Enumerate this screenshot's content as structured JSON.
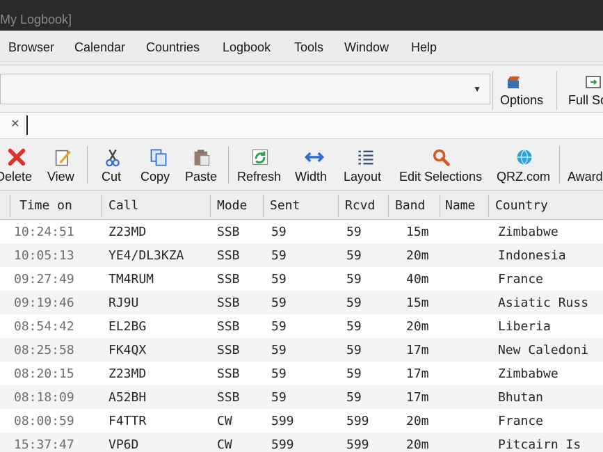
{
  "window": {
    "title": "My Logbook]"
  },
  "menu": [
    "Browser",
    "Calendar",
    "Countries",
    "Logbook",
    "Tools",
    "Window",
    "Help"
  ],
  "address_bar": {
    "value": ""
  },
  "big_buttons": {
    "options": "Options",
    "full_screen": "Full Sc"
  },
  "toolbar": {
    "delete": "Delete",
    "view": "View",
    "cut": "Cut",
    "copy": "Copy",
    "paste": "Paste",
    "refresh": "Refresh",
    "width": "Width",
    "layout": "Layout",
    "edit_selections": "Edit Selections",
    "qrz": "QRZ.com",
    "award": "Award"
  },
  "columns": [
    "Time on",
    "Call",
    "Mode",
    "Sent",
    "Rcvd",
    "Band",
    "Name",
    "Country"
  ],
  "rows": [
    [
      "10:24:51",
      "Z23MD",
      "SSB",
      "59",
      "59",
      "15m",
      "",
      "Zimbabwe"
    ],
    [
      "10:05:13",
      "YE4/DL3KZA",
      "SSB",
      "59",
      "59",
      "20m",
      "",
      "Indonesia"
    ],
    [
      "09:27:49",
      "TM4RUM",
      "SSB",
      "59",
      "59",
      "40m",
      "",
      "France"
    ],
    [
      "09:19:46",
      "RJ9U",
      "SSB",
      "59",
      "59",
      "15m",
      "",
      "Asiatic Russ"
    ],
    [
      "08:54:42",
      "EL2BG",
      "SSB",
      "59",
      "59",
      "20m",
      "",
      "Liberia"
    ],
    [
      "08:25:58",
      "FK4QX",
      "SSB",
      "59",
      "59",
      "17m",
      "",
      "New Caledoni"
    ],
    [
      "08:20:15",
      "Z23MD",
      "SSB",
      "59",
      "59",
      "17m",
      "",
      "Zimbabwe"
    ],
    [
      "08:18:09",
      "A52BH",
      "SSB",
      "59",
      "59",
      "17m",
      "",
      "Bhutan"
    ],
    [
      "08:00:59",
      "F4TTR",
      "CW",
      "599",
      "599",
      "20m",
      "",
      "France"
    ],
    [
      "15:37:47",
      "VP6D",
      "CW",
      "599",
      "599",
      "20m",
      "",
      "Pitcairn Is"
    ]
  ],
  "colors": {
    "delete": "#d9352b",
    "refresh": "#2e9b46",
    "width": "#2f6fd0",
    "search": "#d8572a",
    "globe": "#2aa3d6"
  }
}
